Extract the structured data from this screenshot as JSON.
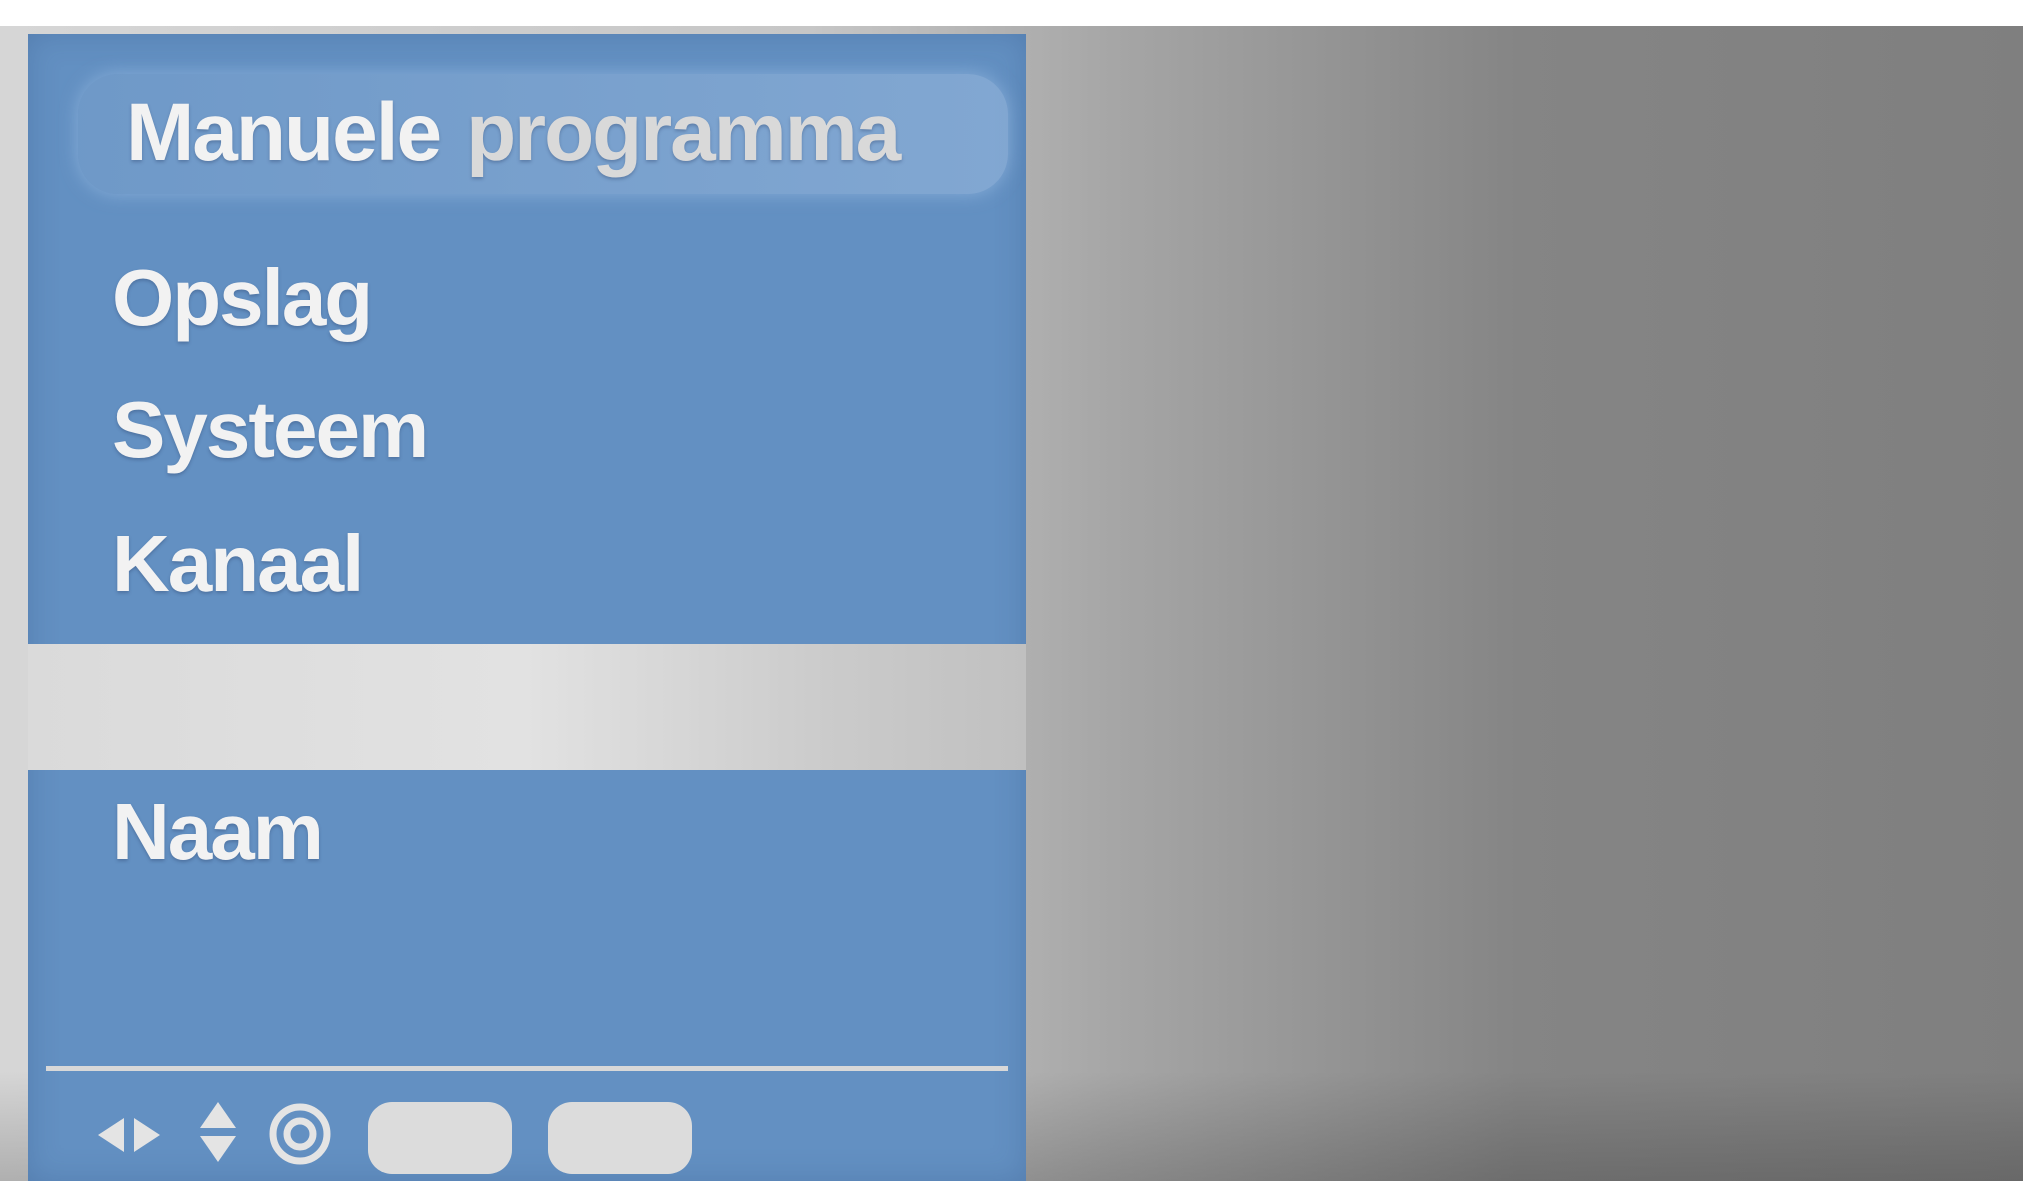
{
  "menu": {
    "title_word1": "Manuele",
    "title_word2": "programma",
    "items": [
      {
        "label": "Opslag"
      },
      {
        "label": "Systeem"
      },
      {
        "label": "Kanaal"
      },
      {
        "label": ""
      },
      {
        "label": "Naam"
      }
    ],
    "selected_index": 3
  },
  "footer": {
    "icons": [
      "left-right-arrows-icon",
      "up-down-arrows-icon",
      "ok-circle-icon"
    ],
    "buttons": [
      "",
      ""
    ]
  },
  "colors": {
    "menu_background": "#6390c2",
    "highlight": "#dadada",
    "text": "#f2f2f2"
  }
}
